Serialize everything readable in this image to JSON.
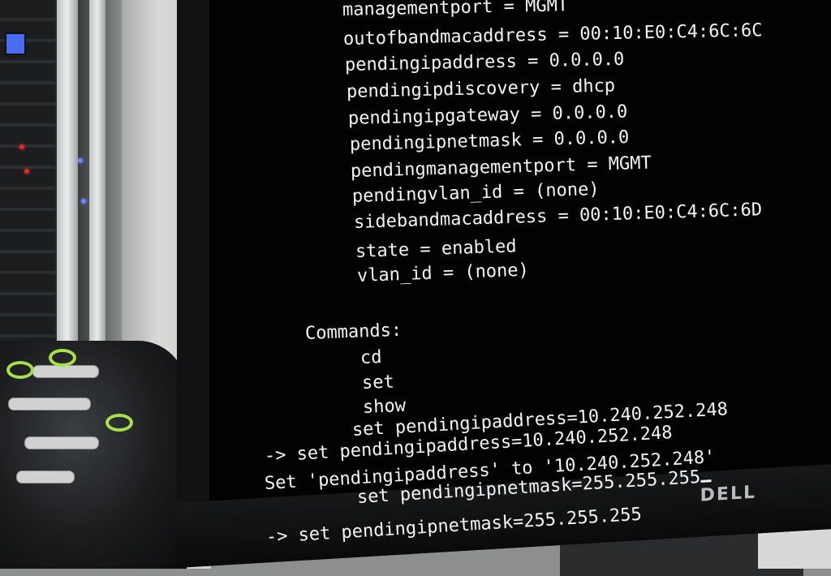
{
  "terminal": {
    "properties": [
      "managementport = MGMT",
      "outofbandmacaddress = 00:10:E0:C4:6C:6C",
      "pendingipaddress = 0.0.0.0",
      "pendingipdiscovery = dhcp",
      "pendingipgateway = 0.0.0.0",
      "pendingipnetmask = 0.0.0.0",
      "pendingmanagementport = MGMT",
      "pendingvlan_id = (none)",
      "sidebandmacaddress = 00:10:E0:C4:6C:6D",
      "state = enabled",
      "vlan_id = (none)"
    ],
    "commands_header": "Commands:",
    "commands": [
      "cd",
      "set",
      "show"
    ],
    "history": [
      "set pendingipaddress=10.240.252.248",
      "-> set pendingipaddress=10.240.252.248",
      "Set 'pendingipaddress' to '10.240.252.248'",
      "set pendingipnetmask=255.255.255",
      "-> set pendingipnetmask=255.255.255"
    ]
  },
  "monitor": {
    "brand": "DELL"
  }
}
